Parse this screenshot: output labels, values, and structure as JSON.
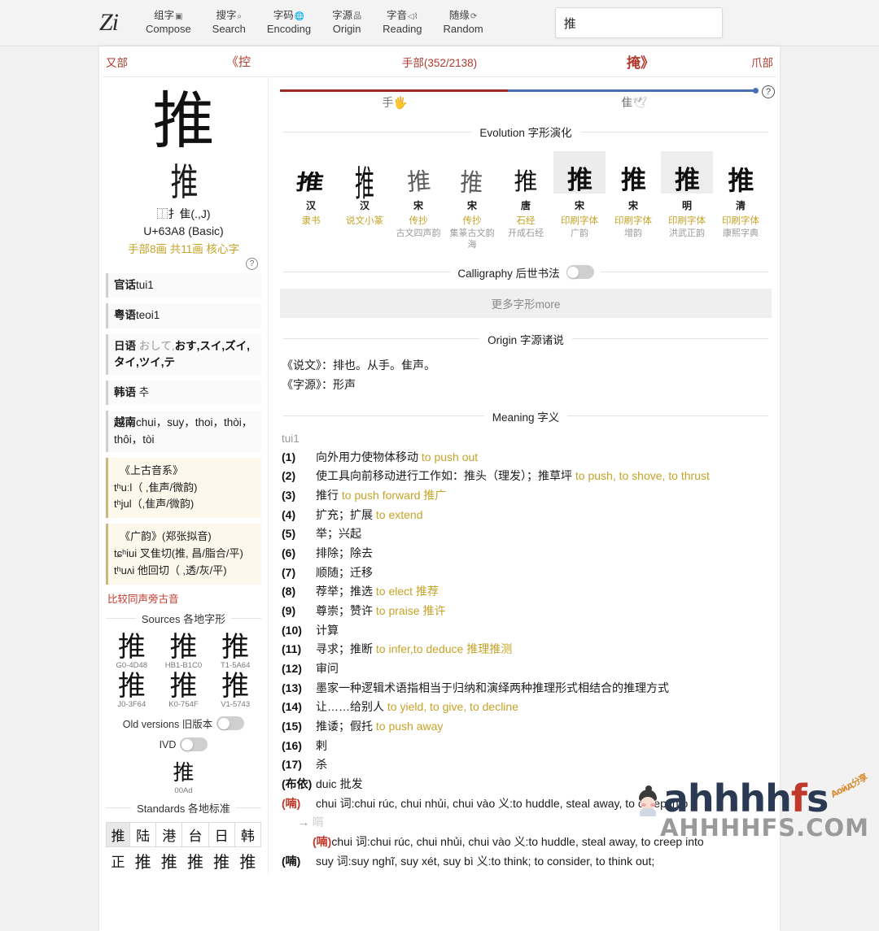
{
  "header": {
    "logo": "Zi",
    "nav": [
      {
        "cn": "组字",
        "icon": "grid-icon",
        "en": "Compose",
        "name": "nav-compose"
      },
      {
        "cn": "搜字",
        "icon": "search-icon",
        "en": "Search",
        "name": "nav-search"
      },
      {
        "cn": "字码",
        "icon": "globe-icon",
        "en": "Encoding",
        "name": "nav-encoding"
      },
      {
        "cn": "字源",
        "icon": "tree-icon",
        "en": "Origin",
        "name": "nav-origin"
      },
      {
        "cn": "字音",
        "icon": "speaker-icon",
        "en": "Reading",
        "name": "nav-reading"
      },
      {
        "cn": "随缘",
        "icon": "shuffle-icon",
        "en": "Random",
        "name": "nav-random"
      }
    ],
    "search": {
      "value": "推",
      "placeholder": ""
    }
  },
  "radical_nav": {
    "prev_radical": "又部",
    "prev_char": "《控",
    "current": "手部(352/2138)",
    "next_char": "掩》",
    "next_radical": "爪部"
  },
  "decomposition_bar": {
    "left_label": "手",
    "left_icon": "hand-glyph",
    "left_pct": 48,
    "right_label": "隹",
    "right_icon": "bird-glyph",
    "right_pct": 52,
    "help": "?"
  },
  "character": {
    "glyph": "推",
    "seal_glyph": "推",
    "decomposition": "⿰扌隹(.,J)",
    "unicode": "U+63A8 (Basic)",
    "strokes": "手部8画 共11画 核心字",
    "help": "?"
  },
  "readings": [
    {
      "label": "官话",
      "value": "tui1",
      "name": "reading-mandarin"
    },
    {
      "label": "粤语",
      "value": "teoi1",
      "name": "reading-cantonese"
    },
    {
      "label": "日语",
      "dim": "おして,",
      "bold": "おす,スイ,ズイ,タイ,ツイ,テ",
      "name": "reading-japanese"
    },
    {
      "label": "韩语",
      "value": "추",
      "name": "reading-korean"
    },
    {
      "label": "越南",
      "value": "chui，suy，thoi，thòi，thôi，tòi",
      "name": "reading-vietnamese"
    }
  ],
  "fanqie": [
    {
      "title": "《上古音系》",
      "lines": [
        "tʰuːl（  ,隹声/微韵)",
        "tʰjul（,隹声/微韵)"
      ],
      "name": "fanqie-shanggu"
    },
    {
      "title": "《广韵》(郑张拟音)",
      "lines": [
        "tɕʰiui 叉隹切(推, 昌/脂合/平)",
        "tʰuʌi 他回切（  ,透/灰/平)"
      ],
      "name": "fanqie-guangyun"
    }
  ],
  "compare_link": "比较同声旁古音",
  "sources": {
    "title": "Sources 各地字形",
    "items": [
      {
        "glyph": "推",
        "code": "G0-4D48"
      },
      {
        "glyph": "推",
        "code": "HB1-B1C0"
      },
      {
        "glyph": "推",
        "code": "T1-5A64"
      },
      {
        "glyph": "推",
        "code": "J0-3F64"
      },
      {
        "glyph": "推",
        "code": "K0-754F"
      },
      {
        "glyph": "推",
        "code": "V1-5743"
      }
    ],
    "old_versions_label": "Old versions 旧版本",
    "old_versions_on": false,
    "ivd_label": "IVD",
    "ivd_on": false,
    "ivd_glyph": "推",
    "ivd_code": "00Ad"
  },
  "standards": {
    "title": "Standards 各地标准",
    "head": [
      "推",
      "陆",
      "港",
      "台",
      "日",
      "韩"
    ],
    "body": [
      "正",
      "推",
      "推",
      "推",
      "推",
      "推"
    ]
  },
  "evolution": {
    "title": "Evolution 字形演化",
    "items": [
      {
        "glyph": "推",
        "era": "汉",
        "style": "隶书",
        "src": ""
      },
      {
        "glyph": "推",
        "era": "汉",
        "style": "说文小篆",
        "src": ""
      },
      {
        "glyph": "推",
        "era": "宋",
        "style": "传抄",
        "src": "古文四声韵"
      },
      {
        "glyph": "推",
        "era": "宋",
        "style": "传抄",
        "src": "集篆古文韵海"
      },
      {
        "glyph": "推",
        "era": "唐",
        "style": "石经",
        "src": "开成石经"
      },
      {
        "glyph": "推",
        "era": "宋",
        "style": "印刷字体",
        "src": "广韵"
      },
      {
        "glyph": "推",
        "era": "宋",
        "style": "印刷字体",
        "src": "增韵"
      },
      {
        "glyph": "推",
        "era": "明",
        "style": "印刷字体",
        "src": "洪武正韵"
      },
      {
        "glyph": "推",
        "era": "清",
        "style": "印刷字体",
        "src": "康熙字典"
      }
    ]
  },
  "calligraphy": {
    "label": "Calligraphy 后世书法",
    "on": false
  },
  "more_button": "更多字形more",
  "origin": {
    "title": "Origin 字源诸说",
    "lines": [
      "《说文》：排也。从手。隹声。",
      "《字源》：形声"
    ]
  },
  "meaning": {
    "title": "Meaning 字义",
    "pronunciation": "tui1",
    "definitions": [
      {
        "num": "(1)",
        "cn": "向外用力使物体移动 ",
        "en": "to push out",
        "tail": ""
      },
      {
        "num": "(2)",
        "cn": "使工具向前移动进行工作如：推头（理发）；推草坪 ",
        "en": "to push, to shove, to thrust",
        "tail": ""
      },
      {
        "num": "(3)",
        "cn": "推行 ",
        "en": "to push forward ",
        "link": "推广"
      },
      {
        "num": "(4)",
        "cn": "扩充；扩展 ",
        "en": "to extend",
        "tail": ""
      },
      {
        "num": "(5)",
        "cn": "举；兴起",
        "en": "",
        "tail": ""
      },
      {
        "num": "(6)",
        "cn": "排除；除去",
        "en": "",
        "tail": ""
      },
      {
        "num": "(7)",
        "cn": "顺随；迁移",
        "en": "",
        "tail": ""
      },
      {
        "num": "(8)",
        "cn": "荐举；推选 ",
        "en": "to elect ",
        "link": "推荐"
      },
      {
        "num": "(9)",
        "cn": "尊崇；赞许 ",
        "en": "to praise ",
        "link": "推许"
      },
      {
        "num": "(10)",
        "cn": "计算",
        "en": "",
        "tail": ""
      },
      {
        "num": "(11)",
        "cn": "寻求；推断 ",
        "en": "to infer,to deduce ",
        "link": "推理推测"
      },
      {
        "num": "(12)",
        "cn": "审问",
        "en": "",
        "tail": ""
      },
      {
        "num": "(13)",
        "cn": "墨家一种逻辑术语指相当于归纳和演绎两种推理形式相结合的推理方式",
        "en": "",
        "tail": ""
      },
      {
        "num": "(14)",
        "cn": "让……给别人 ",
        "en": "to yield, to give, to decline",
        "tail": ""
      },
      {
        "num": "(15)",
        "cn": "推诿；假托 ",
        "en": "to push away",
        "tail": ""
      },
      {
        "num": "(16)",
        "cn": "剌",
        "en": "",
        "tail": ""
      },
      {
        "num": "(17)",
        "cn": "杀",
        "en": "",
        "tail": ""
      }
    ],
    "dialects": [
      {
        "tag": "(布依)",
        "text": "duic 批发",
        "red": false
      },
      {
        "tag": "(喃)",
        "text": "chui 词:chui rúc, chui nhủi, chui vào 义:to huddle, steal away, to creep into",
        "red": true
      }
    ],
    "nested": {
      "arrow": "→",
      "ghost": "𠿫",
      "tag": "(喃)",
      "text": "chui 词:chui rúc, chui nhủi, chui vào 义:to huddle, steal away, to creep into"
    },
    "last": {
      "tag": "(喃)",
      "text": "suy 词:suy nghĩ, suy xét, suy bì 义:to think; to consider, to think out;"
    }
  },
  "watermark": {
    "main": "ahhhhfs",
    "badge": "Aойд分享",
    "sub": "AHHHHFS.COM"
  }
}
